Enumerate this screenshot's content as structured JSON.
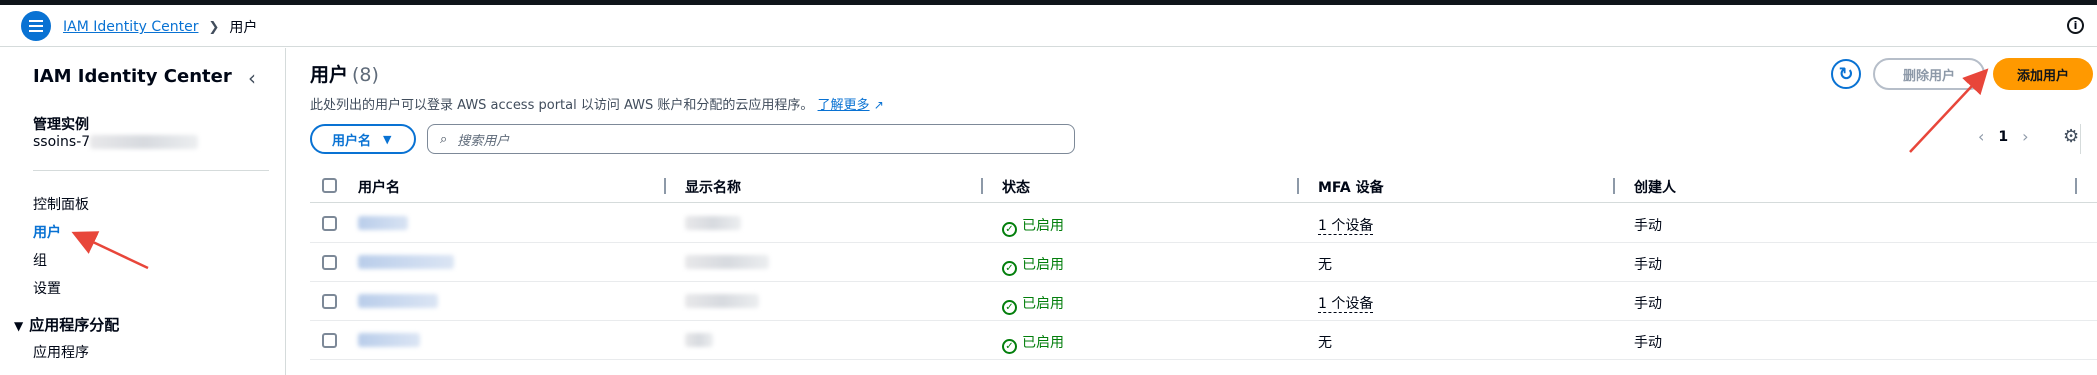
{
  "topbar": {
    "breadcrumb": [
      "IAM Identity Center",
      "用户"
    ]
  },
  "sidebar": {
    "title": "IAM Identity Center",
    "instance_label": "管理实例",
    "instance_value": "ssoins-7",
    "items": [
      "控制面板",
      "用户",
      "组",
      "设置"
    ],
    "section": "应用程序分配",
    "section_items": [
      "应用程序"
    ]
  },
  "main": {
    "title": "用户",
    "count": "(8)",
    "description": "此处列出的用户可以登录 AWS access portal 以访问 AWS 账户和分配的云应用程序。",
    "learn_more": "了解更多",
    "delete_button": "删除用户",
    "add_button": "添加用户",
    "filter_property": "用户名",
    "search_placeholder": "搜索用户",
    "page": "1"
  },
  "table": {
    "columns": [
      "用户名",
      "显示名称",
      "状态",
      "MFA 设备",
      "创建人"
    ],
    "rows": [
      {
        "status": "已启用",
        "mfa": "1 个设备",
        "created_by": "手动"
      },
      {
        "status": "已启用",
        "mfa": "无",
        "created_by": "手动"
      },
      {
        "status": "已启用",
        "mfa": "1 个设备",
        "created_by": "手动"
      },
      {
        "status": "已启用",
        "mfa": "无",
        "created_by": "手动"
      }
    ]
  },
  "colors": {
    "accent": "#0972d3",
    "primary_button": "#ff9900",
    "success": "#037f0c",
    "annotation": "#e8463a"
  }
}
